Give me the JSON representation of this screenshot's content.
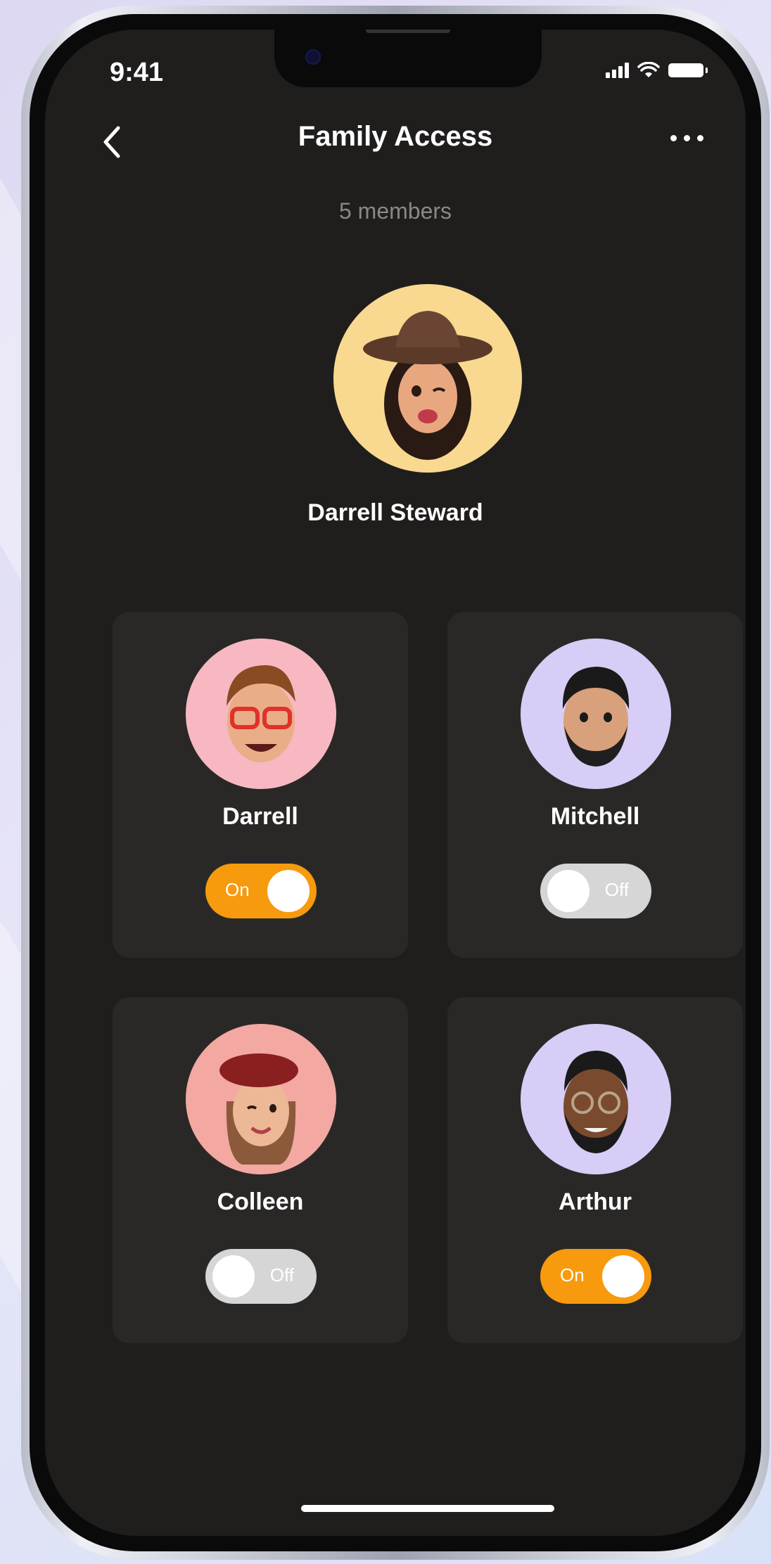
{
  "status_bar": {
    "time": "9:41"
  },
  "header": {
    "title": "Family Access"
  },
  "members_count": "5 members",
  "owner": {
    "name": "Darrell Steward"
  },
  "members": [
    {
      "name": "Darrell",
      "toggle": "On",
      "on": true,
      "avatar_bg": "#f7b8c2"
    },
    {
      "name": "Mitchell",
      "toggle": "Off",
      "on": false,
      "avatar_bg": "#d7cdf6"
    },
    {
      "name": "Colleen",
      "toggle": "Off",
      "on": false,
      "avatar_bg": "#f3a8a2"
    },
    {
      "name": "Arthur",
      "toggle": "On",
      "on": true,
      "avatar_bg": "#d7cdf6"
    }
  ],
  "colors": {
    "accent": "#f79a0d",
    "background": "#201e1d",
    "card": "#2a2827",
    "toggle_off": "#d6d6d6"
  }
}
